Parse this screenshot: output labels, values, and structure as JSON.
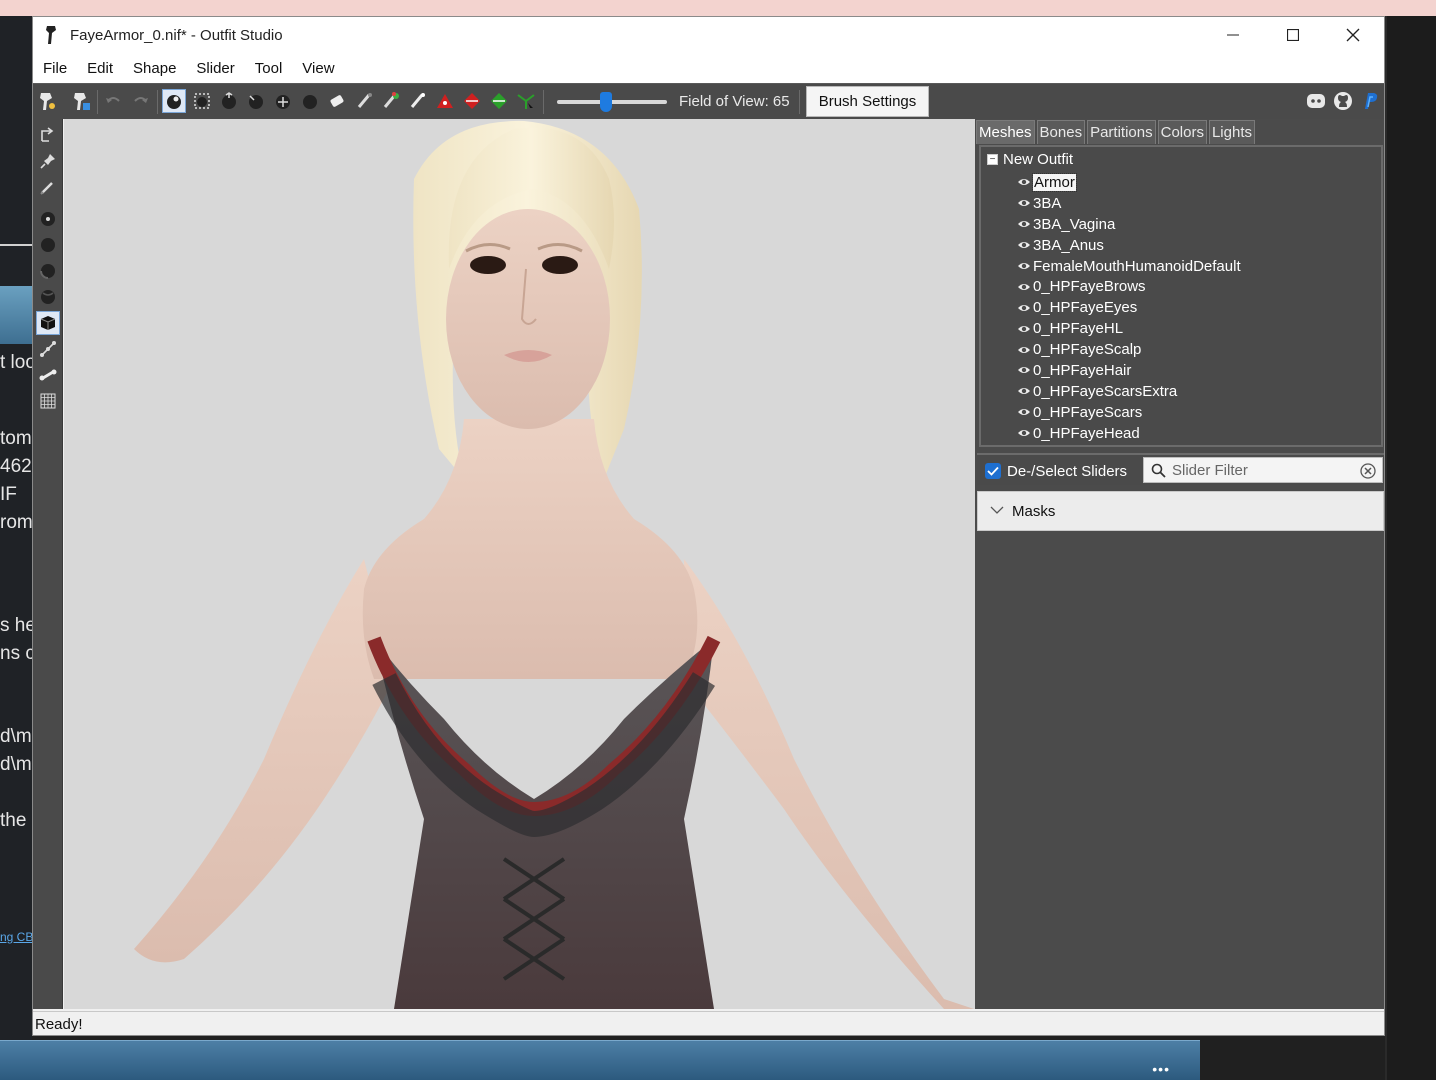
{
  "background": {
    "fragments": [
      "t loo",
      "tom",
      "462",
      "IF",
      "rom",
      "s he",
      "ns c",
      "d\\m",
      "d\\m",
      "the",
      "ng CBI"
    ],
    "taskbar_dots": "•••"
  },
  "window": {
    "title": "FayeArmor_0.nif* - Outfit Studio"
  },
  "menu": [
    "File",
    "Edit",
    "Shape",
    "Slider",
    "Tool",
    "View"
  ],
  "toolbar": {
    "fov_label": "Field of View: 65",
    "fov_value": 65,
    "brush_settings_label": "Brush Settings"
  },
  "panel": {
    "tabs": [
      "Meshes",
      "Bones",
      "Partitions",
      "Colors",
      "Lights"
    ],
    "active_tab": "Meshes",
    "tree_root": "New Outfit",
    "tree_toggle": "−",
    "meshes": [
      "Armor",
      "3BA",
      "3BA_Vagina",
      "3BA_Anus",
      "FemaleMouthHumanoidDefault",
      "0_HPFayeBrows",
      "0_HPFayeEyes",
      "0_HPFayeHL",
      "0_HPFayeScalp",
      "0_HPFayeHair",
      "0_HPFayeScarsExtra",
      "0_HPFayeScars",
      "0_HPFayeHead"
    ],
    "selected_mesh": "Armor",
    "deselect_label": "De-/Select Sliders",
    "slider_filter_placeholder": "Slider Filter",
    "masks_label": "Masks"
  },
  "status": {
    "text": "Ready!"
  },
  "colors": {
    "accent": "#1e7be0",
    "toolbar_bg": "#4a4a4a",
    "viewport_bg": "#d8d8d8"
  }
}
